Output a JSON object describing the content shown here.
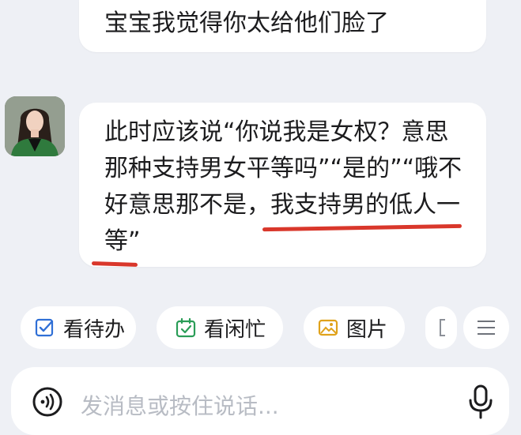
{
  "messages": [
    {
      "sender": "self",
      "text": "宝宝我觉得你太给他们脸了"
    },
    {
      "sender": "other",
      "avatar": "woman-portrait-avatar",
      "lines": [
        "此时应该说“你说我是女权？意思",
        "那种支持男女平等吗”“是的”“哦不",
        "好意思那不是，我支持男的低人一",
        "等”"
      ],
      "annotation_color": "#d9372b"
    }
  ],
  "quick_actions": [
    {
      "label": "看待办",
      "icon": "todo-check-icon",
      "color": "#2f6fd6"
    },
    {
      "label": "看闲忙",
      "icon": "calendar-check-icon",
      "color": "#2a9d57"
    },
    {
      "label": "图片",
      "icon": "image-icon",
      "color": "#e0a21b"
    }
  ],
  "menu_icon": "hamburger-menu-icon",
  "input": {
    "placeholder": "发消息或按住说话...",
    "voice_icon": "voice-wave-icon",
    "mic_icon": "microphone-icon"
  }
}
